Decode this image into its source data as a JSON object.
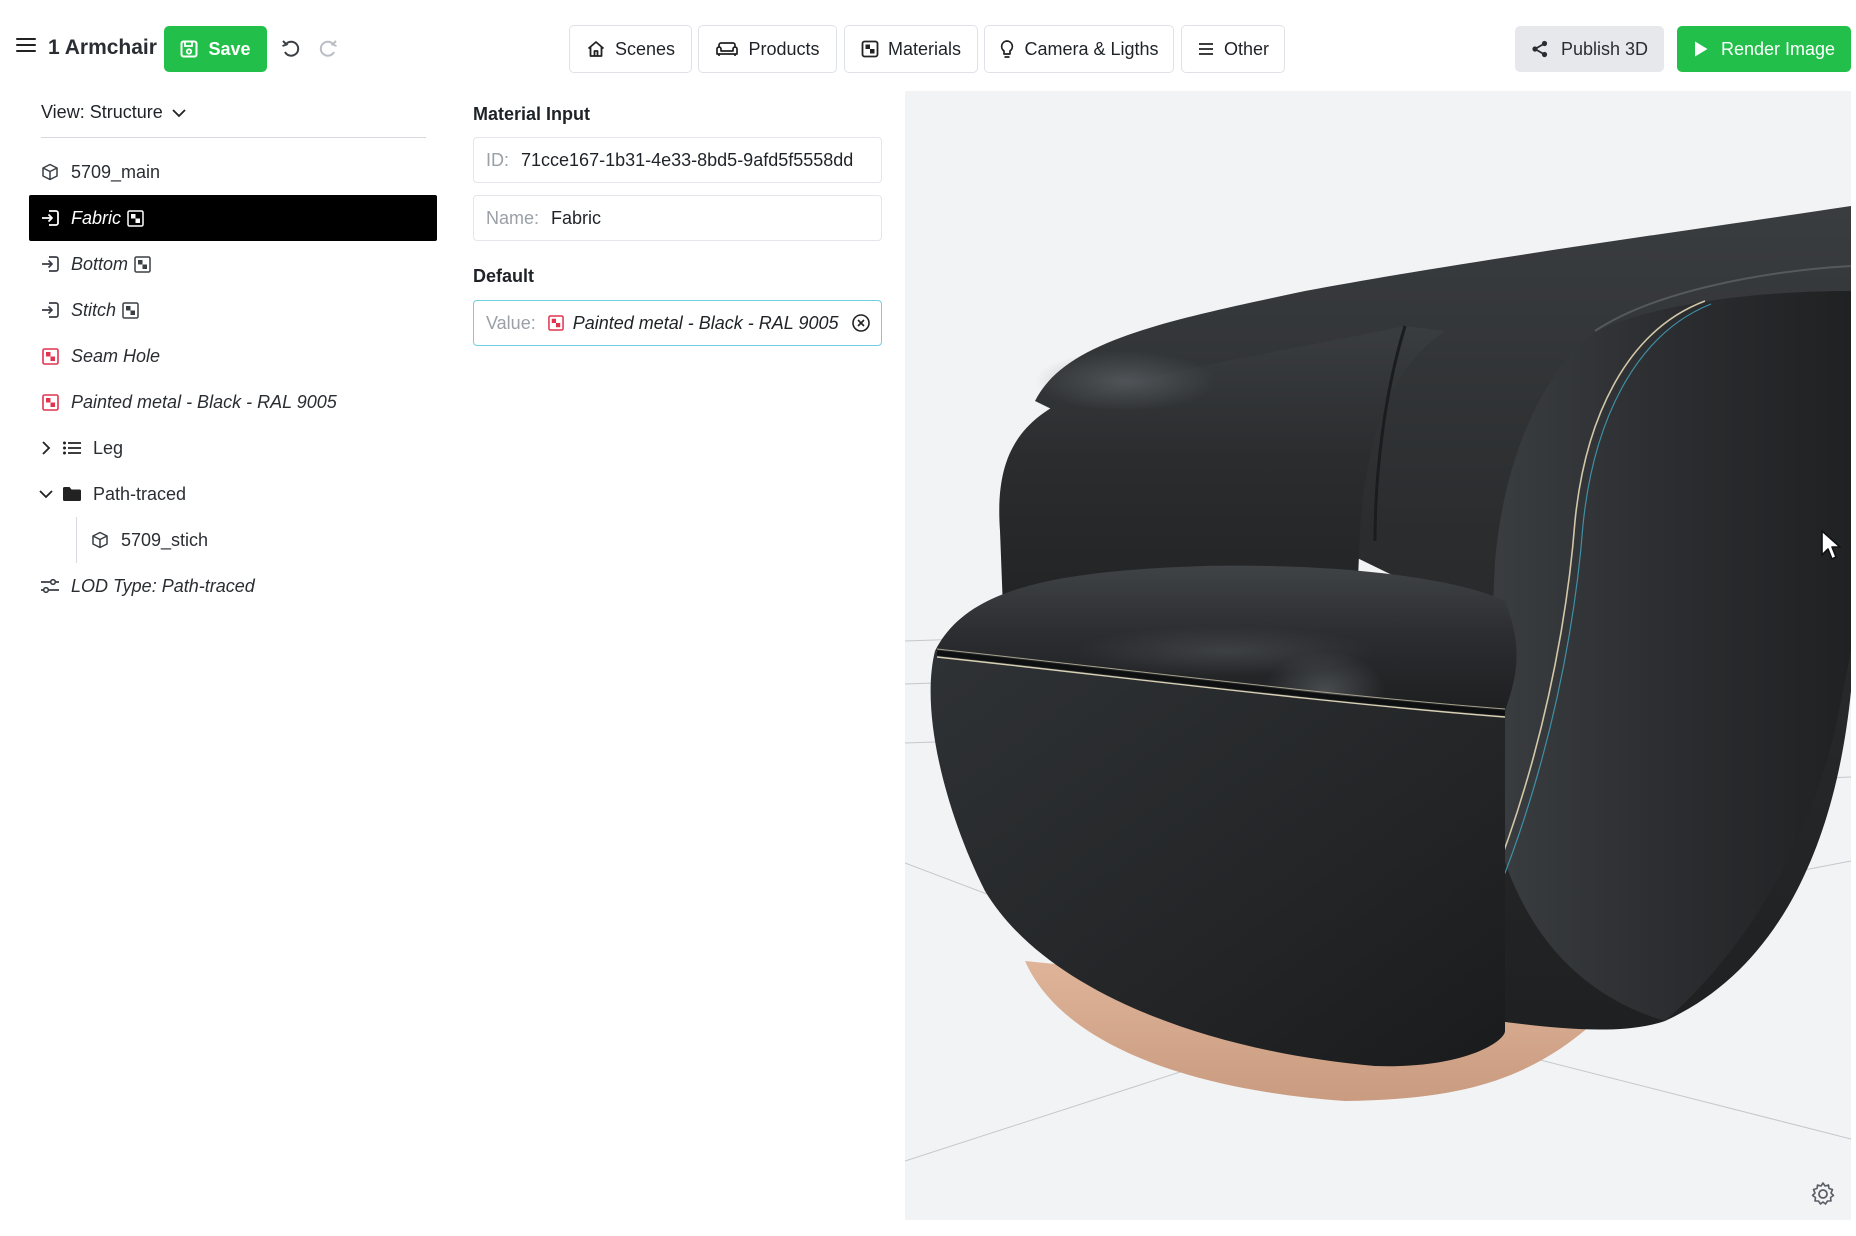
{
  "header": {
    "title": "1 Armchair",
    "save_label": "Save",
    "tabs": [
      {
        "label": "Scenes",
        "icon": "home-icon"
      },
      {
        "label": "Products",
        "icon": "sofa-icon"
      },
      {
        "label": "Materials",
        "icon": "material-icon"
      },
      {
        "label": "Camera & Ligths",
        "icon": "lightbulb-icon"
      },
      {
        "label": "Other",
        "icon": "list-icon"
      }
    ],
    "publish_label": "Publish 3D",
    "render_label": "Render Image"
  },
  "sidebar": {
    "view_label": "View: Structure",
    "items": [
      {
        "label": "5709_main",
        "icon": "cube-icon"
      },
      {
        "label": "Fabric",
        "icon": "material-input-icon",
        "selected": true
      },
      {
        "label": "Bottom",
        "icon": "material-input-icon"
      },
      {
        "label": "Stitch",
        "icon": "material-input-icon"
      },
      {
        "label": "Seam Hole",
        "icon": "material-swatch-icon"
      },
      {
        "label": "Painted metal - Black - RAL 9005",
        "icon": "material-swatch-icon"
      },
      {
        "label": "Leg",
        "icon": "list-icon"
      },
      {
        "label": "Path-traced",
        "icon": "folder-icon"
      },
      {
        "label": "5709_stich",
        "icon": "cube-icon"
      },
      {
        "label": "LOD Type: Path-traced",
        "icon": "sliders-icon"
      }
    ]
  },
  "panel": {
    "heading": "Material Input",
    "id_label": "ID:",
    "id_value": "71cce167-1b31-4e33-8bd5-9afd5f5558dd",
    "name_label": "Name:",
    "name_value": "Fabric",
    "default_heading": "Default",
    "value_label": "Value:",
    "value_value": "Painted metal - Black - RAL 9005"
  },
  "colors": {
    "accent_green": "#22c04a",
    "selected_bg": "#000000",
    "swatch_red": "#e0334f",
    "value_border": "#72cfe0",
    "viewport_bg": "#f2f3f5"
  }
}
